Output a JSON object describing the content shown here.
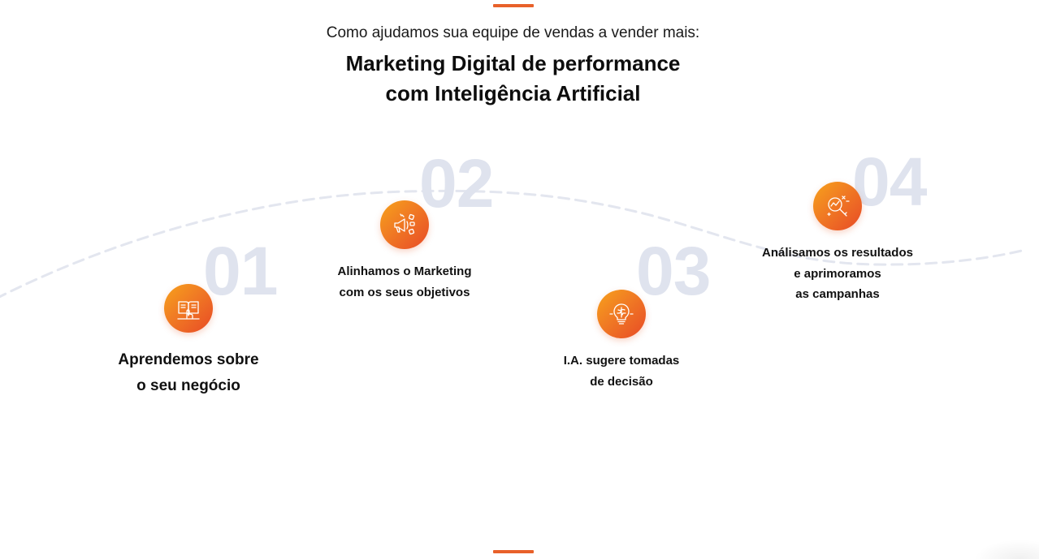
{
  "header": {
    "eyebrow": "Como ajudamos sua equipe de vendas a vender mais:",
    "title_line1": "Marketing Digital de performance",
    "title_line2": "com Inteligência Artificial"
  },
  "colors": {
    "accent": "#e8612a",
    "icon_gradient_start": "#f7a21b",
    "icon_gradient_end": "#e84a26",
    "step_number": "#dfe3ee",
    "curve": "#e3e6ef"
  },
  "steps": [
    {
      "number": "01",
      "icon": "book-hand-icon",
      "label_line1": "Aprendemos sobre",
      "label_line2": "o seu negócio",
      "label_line3": ""
    },
    {
      "number": "02",
      "icon": "megaphone-icon",
      "label_line1": "Alinhamos o Marketing",
      "label_line2": "com os seus objetivos",
      "label_line3": ""
    },
    {
      "number": "03",
      "icon": "ai-lightbulb-icon",
      "label_line1": "I.A. sugere tomadas",
      "label_line2": "de decisão",
      "label_line3": ""
    },
    {
      "number": "04",
      "icon": "magnifier-chart-icon",
      "label_line1": "Análisamos os resultados",
      "label_line2": "e aprimoramos",
      "label_line3": "as campanhas"
    }
  ]
}
